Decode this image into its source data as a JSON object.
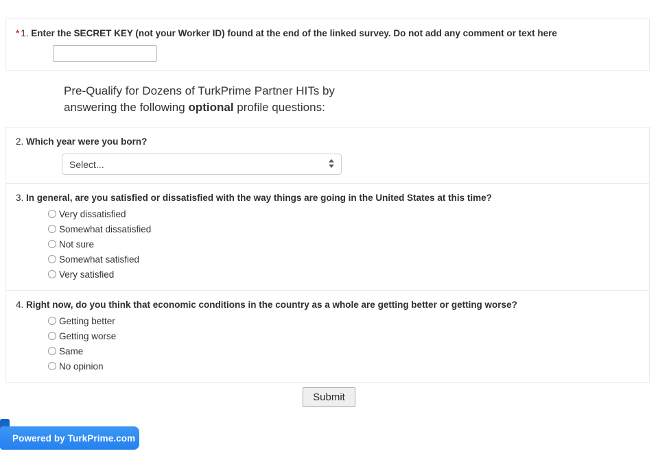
{
  "form": {
    "questions": [
      {
        "number": "1.",
        "required_marker": "*",
        "text": "Enter the SECRET KEY (not your Worker ID) found at the end of the linked survey. Do not add any comment or text here",
        "input_value": "",
        "input_placeholder": ""
      },
      {
        "number": "2.",
        "text": "Which year were you born?",
        "select_value": "Select..."
      },
      {
        "number": "3.",
        "text": "In general, are you satisfied or dissatisfied with the way things are going in the United States at this time?",
        "options": [
          "Very dissatisfied",
          "Somewhat dissatisfied",
          "Not sure",
          "Somewhat satisfied",
          "Very satisfied"
        ]
      },
      {
        "number": "4.",
        "text": "Right now, do you think that economic conditions in the country as a whole are getting better or getting worse?",
        "options": [
          "Getting better",
          "Getting worse",
          "Same",
          "No opinion"
        ]
      }
    ],
    "intro": {
      "line1": "Pre-Qualify for Dozens of TurkPrime Partner HITs by",
      "line2_before": "answering the following ",
      "line2_emphasis": "optional",
      "line2_after": " profile questions:"
    },
    "submit_label": "Submit"
  },
  "footer": {
    "powered_by": "Powered by TurkPrime.com"
  },
  "colors": {
    "required_asterisk": "#e03030",
    "ribbon_blue": "#2481ef",
    "ribbon_fold": "#1565c8",
    "card_border": "#e3ebf0"
  }
}
